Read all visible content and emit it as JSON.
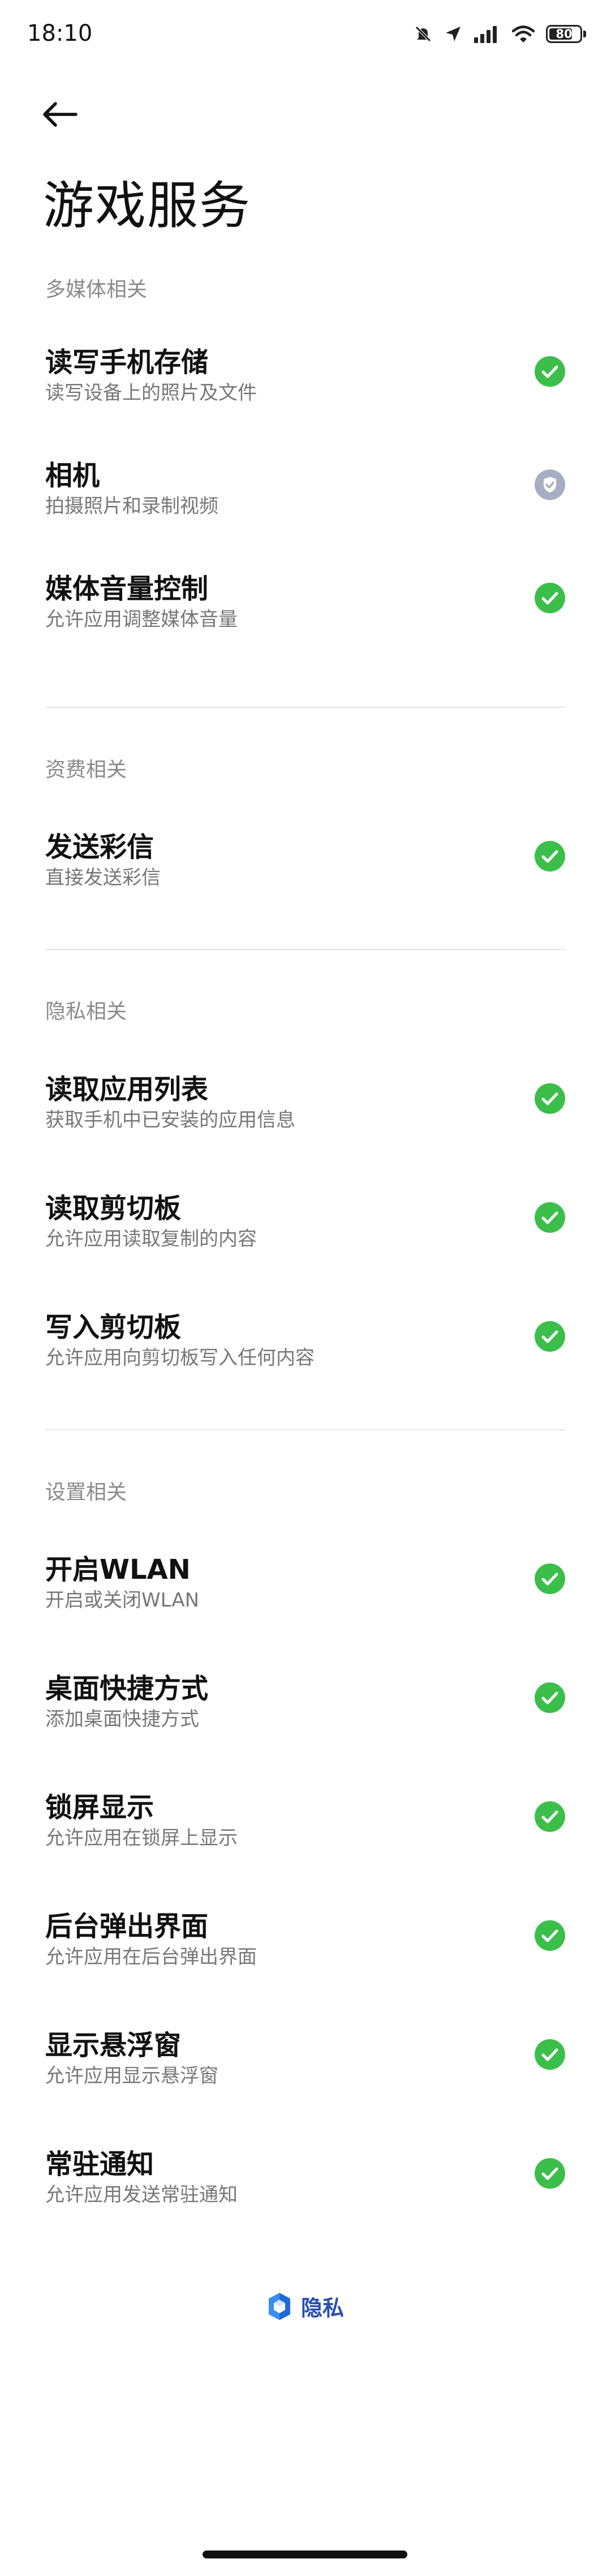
{
  "status_bar": {
    "time": "18:10",
    "battery": "80",
    "battery_level": 0.8,
    "icons": [
      "mute-icon",
      "location-icon",
      "signal-icon",
      "wifi-icon",
      "battery-icon"
    ]
  },
  "header": {
    "back_icon": "arrow-left-icon",
    "title": "游戏服务"
  },
  "colors": {
    "granted": "#3bbf4a",
    "inactive": "#a7aec4",
    "section": "#8a8a8a",
    "footer_brand": "#2a4db0"
  },
  "sections": [
    {
      "label": "多媒体相关",
      "items": [
        {
          "title": "读写手机存储",
          "desc": "读写设备上的照片及文件",
          "status": "granted"
        },
        {
          "title": "相机",
          "desc": "拍摄照片和录制视频",
          "status": "inactive"
        },
        {
          "title": "媒体音量控制",
          "desc": "允许应用调整媒体音量",
          "status": "granted"
        }
      ]
    },
    {
      "label": "资费相关",
      "items": [
        {
          "title": "发送彩信",
          "desc": "直接发送彩信",
          "status": "granted"
        }
      ]
    },
    {
      "label": "隐私相关",
      "items": [
        {
          "title": "读取应用列表",
          "desc": "获取手机中已安装的应用信息",
          "status": "granted"
        },
        {
          "title": "读取剪切板",
          "desc": "允许应用读取复制的内容",
          "status": "granted"
        },
        {
          "title": "写入剪切板",
          "desc": "允许应用向剪切板写入任何内容",
          "status": "granted"
        }
      ]
    },
    {
      "label": "设置相关",
      "items": [
        {
          "title": "开启WLAN",
          "desc": "开启或关闭WLAN",
          "status": "granted"
        },
        {
          "title": "桌面快捷方式",
          "desc": "添加桌面快捷方式",
          "status": "granted"
        },
        {
          "title": "锁屏显示",
          "desc": "允许应用在锁屏上显示",
          "status": "granted"
        },
        {
          "title": "后台弹出界面",
          "desc": "允许应用在后台弹出界面",
          "status": "granted"
        },
        {
          "title": "显示悬浮窗",
          "desc": "允许应用显示悬浮窗",
          "status": "granted"
        },
        {
          "title": "常驻通知",
          "desc": "允许应用发送常驻通知",
          "status": "granted"
        }
      ]
    }
  ],
  "footer": {
    "logo_icon": "privacy-shield-icon",
    "label": "隐私"
  }
}
